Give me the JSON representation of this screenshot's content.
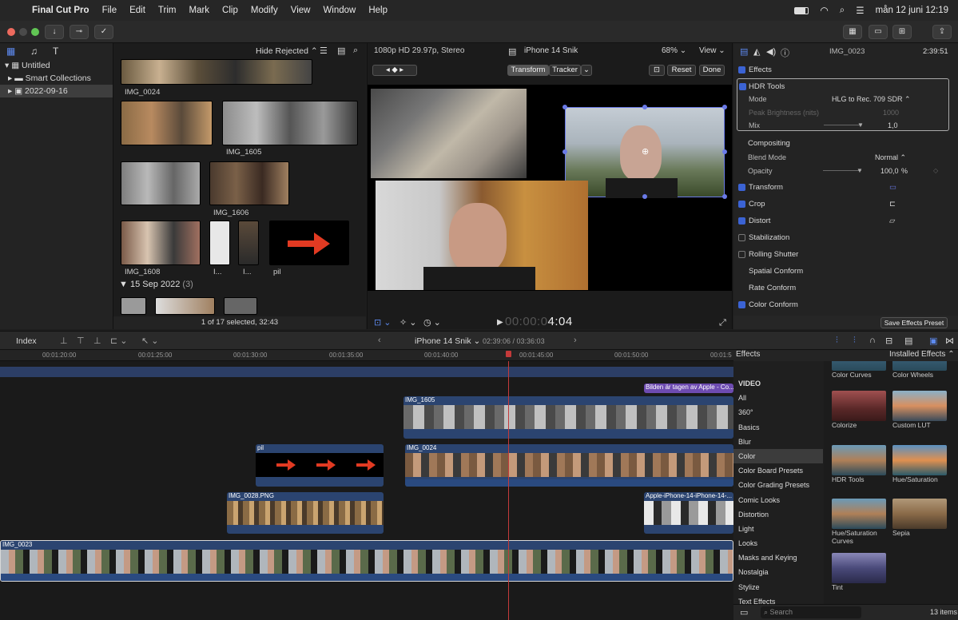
{
  "menubar": {
    "app": "Final Cut Pro",
    "items": [
      "File",
      "Edit",
      "Trim",
      "Mark",
      "Clip",
      "Modify",
      "View",
      "Window",
      "Help"
    ],
    "clock": "mån 12 juni 12:19"
  },
  "library": {
    "root": "Untitled",
    "items": [
      "Smart Collections",
      "2022-09-16"
    ]
  },
  "browser": {
    "filter": "Hide Rejected",
    "clips": [
      "IMG_0024",
      "IMG_1605",
      "IMG_1606",
      "IMG_1608",
      "I...",
      "I...",
      "pil"
    ],
    "section2": "15 Sep 2022",
    "section2_count": "(3)",
    "status": "1 of 17 selected, 32:43"
  },
  "viewer": {
    "format": "1080p HD 29.97p, Stereo",
    "project": "iPhone 14 Snik",
    "zoom": "68%",
    "view": "View",
    "transform": "Transform",
    "tracker": "Tracker",
    "reset": "Reset",
    "done": "Done",
    "timecode_dim": "00:00:0",
    "timecode": "4:04"
  },
  "inspector": {
    "clip": "IMG_0023",
    "duration": "2:39:51",
    "effects": "Effects",
    "hdr": "HDR Tools",
    "mode_label": "Mode",
    "mode_value": "HLG to Rec. 709 SDR",
    "peak_label": "Peak Brightness (nits)",
    "peak_value": "1000",
    "mix_label": "Mix",
    "mix_value": "1,0",
    "compositing": "Compositing",
    "blend_label": "Blend Mode",
    "blend_value": "Normal",
    "opacity_label": "Opacity",
    "opacity_value": "100,0",
    "opacity_unit": "%",
    "sections": [
      "Transform",
      "Crop",
      "Distort",
      "Stabilization",
      "Rolling Shutter",
      "Spatial Conform",
      "Rate Conform",
      "Color Conform"
    ],
    "save": "Save Effects Preset"
  },
  "timeline": {
    "index": "Index",
    "project": "iPhone 14 Snik",
    "tc": "02:39:06 / 03:36:03",
    "ruler": [
      "00:01:20:00",
      "00:01:25:00",
      "00:01:30:00",
      "00:01:35:00",
      "00:01:40:00",
      "00:01:45:00",
      "00:01:50:00",
      "00:01:5"
    ],
    "clips": {
      "title": "Bilden är tagen av Apple - Co...",
      "c1605": "IMG_1605",
      "pil": "pil",
      "c0024": "IMG_0024",
      "png": "IMG_0028.PNG",
      "apple": "Apple-iPhone-14-iPhone-14-...",
      "c0023": "IMG_0023"
    }
  },
  "effects_browser": {
    "title": "Effects",
    "installed": "Installed Effects",
    "categories": [
      "VIDEO",
      "All",
      "360°",
      "Basics",
      "Blur",
      "Color",
      "Color Board Presets",
      "Color Grading Presets",
      "Comic Looks",
      "Distortion",
      "Light",
      "Looks",
      "Masks and Keying",
      "Nostalgia",
      "Stylize",
      "Text Effects"
    ],
    "selected": "Color",
    "items": [
      "Color Curves",
      "Color Wheels",
      "Colorize",
      "Custom LUT",
      "HDR Tools",
      "Hue/Saturation",
      "Hue/Saturation Curves",
      "Sepia",
      "Tint"
    ],
    "search": "Search",
    "count": "13 items"
  }
}
